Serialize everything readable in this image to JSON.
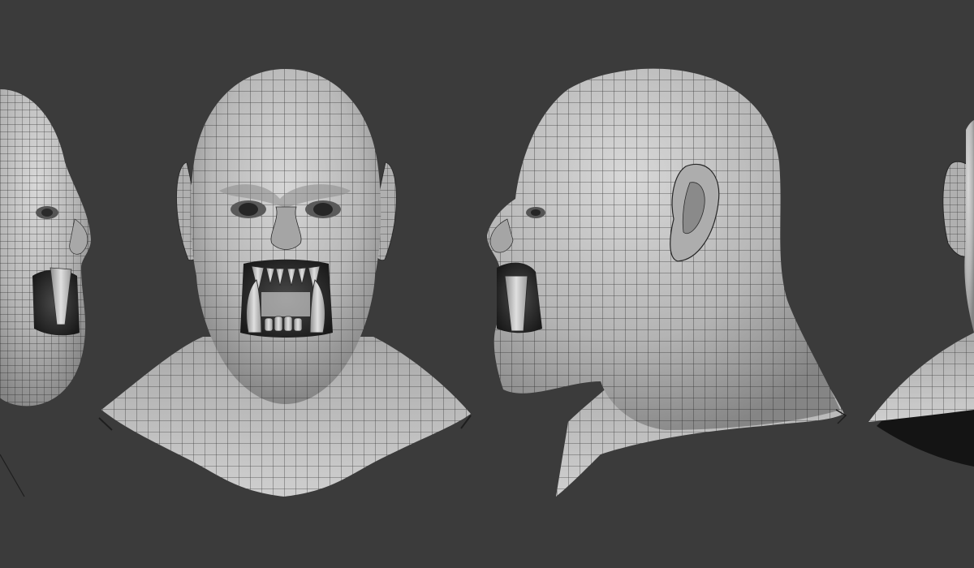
{
  "scene": {
    "background_color": "#3b3b3b",
    "mesh_fill_color": "#bdbdbd",
    "wire_color": "#1e1e1e",
    "views": [
      {
        "name": "left-partial-profile",
        "facing": "right"
      },
      {
        "name": "front",
        "facing": "viewer"
      },
      {
        "name": "side-profile",
        "facing": "left"
      },
      {
        "name": "right-partial-back",
        "facing": "left"
      }
    ]
  }
}
